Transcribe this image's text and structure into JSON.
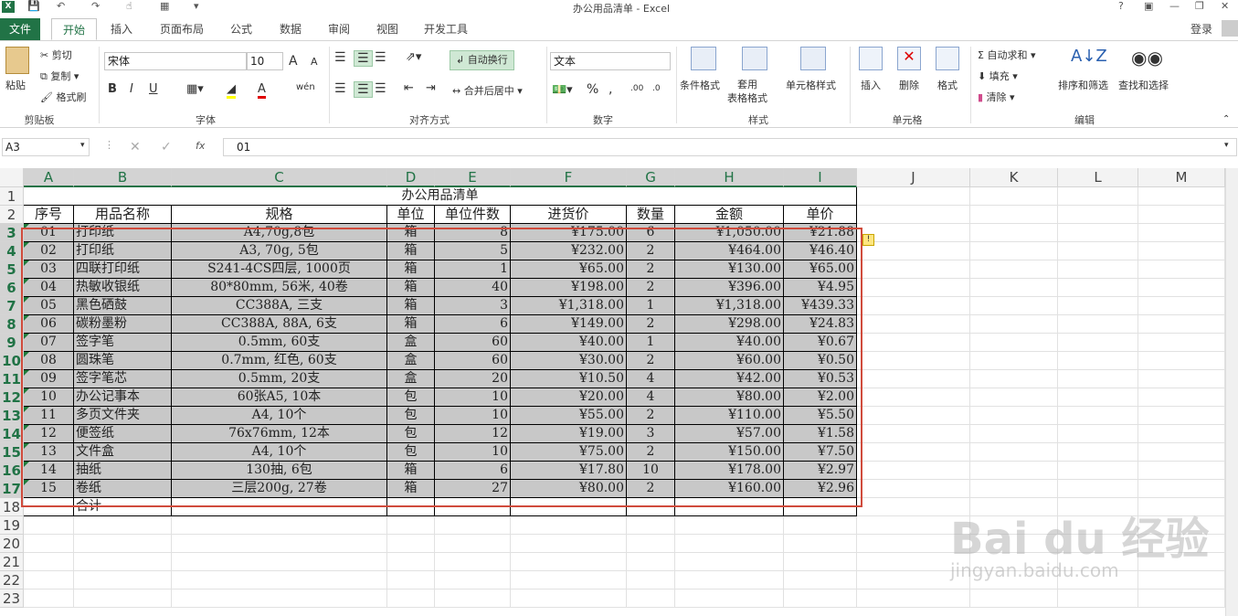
{
  "window": {
    "title": "办公用品清单 - Excel",
    "help": "?",
    "controls": [
      "▣",
      "—",
      "❐",
      "✕"
    ]
  },
  "tabs": [
    "文件",
    "开始",
    "插入",
    "页面布局",
    "公式",
    "数据",
    "审阅",
    "视图",
    "开发工具"
  ],
  "active_tab": "开始",
  "login": "登录",
  "ribbon": {
    "clipboard": {
      "paste": "粘贴",
      "cut": "剪切",
      "copy": "复制",
      "format_painter": "格式刷",
      "label": "剪贴板"
    },
    "font": {
      "name": "宋体",
      "size": "10",
      "bold": "B",
      "italic": "I",
      "underline": "U",
      "label": "字体"
    },
    "align": {
      "wrap": "自动换行",
      "merge": "合并后居中",
      "label": "对齐方式"
    },
    "number": {
      "format": "文本",
      "percent": "%",
      "comma": ",",
      "label": "数字"
    },
    "styles": {
      "cond": "条件格式",
      "table": "套用\n表格格式",
      "cell": "单元格样式",
      "label": "样式"
    },
    "cells": {
      "insert": "插入",
      "delete": "删除",
      "format": "格式",
      "label": "单元格"
    },
    "editing": {
      "autosum": "自动求和",
      "fill": "填充",
      "clear": "清除",
      "sort": "排序和筛选",
      "find": "查找和选择",
      "label": "编辑"
    },
    "font_grow": "A",
    "font_shrink": "A"
  },
  "formula_bar": {
    "name_box": "A3",
    "fx": "fx",
    "value": "01"
  },
  "columns": [
    "A",
    "B",
    "C",
    "D",
    "E",
    "F",
    "G",
    "H",
    "I",
    "J",
    "K",
    "L",
    "M"
  ],
  "rows": [
    "1",
    "2",
    "3",
    "4",
    "5",
    "6",
    "7",
    "8",
    "9",
    "10",
    "11",
    "12",
    "13",
    "14",
    "15",
    "16",
    "17",
    "18",
    "19",
    "20",
    "21",
    "22",
    "23"
  ],
  "sheet": {
    "title": "办公用品清单",
    "headers": [
      "序号",
      "用品名称",
      "规格",
      "单位",
      "单位件数",
      "进货价",
      "数量",
      "金额",
      "单价"
    ],
    "data": [
      [
        "01",
        "打印纸",
        "A4,70g,8包",
        "箱",
        "8",
        "¥175.00",
        "6",
        "¥1,050.00",
        "¥21.88"
      ],
      [
        "02",
        "打印纸",
        "A3, 70g, 5包",
        "箱",
        "5",
        "¥232.00",
        "2",
        "¥464.00",
        "¥46.40"
      ],
      [
        "03",
        "四联打印纸",
        "S241-4CS四层, 1000页",
        "箱",
        "1",
        "¥65.00",
        "2",
        "¥130.00",
        "¥65.00"
      ],
      [
        "04",
        "热敏收银纸",
        "80*80mm, 56米, 40卷",
        "箱",
        "40",
        "¥198.00",
        "2",
        "¥396.00",
        "¥4.95"
      ],
      [
        "05",
        "黑色硒鼓",
        "CC388A, 三支",
        "箱",
        "3",
        "¥1,318.00",
        "1",
        "¥1,318.00",
        "¥439.33"
      ],
      [
        "06",
        "碳粉墨粉",
        "CC388A, 88A, 6支",
        "箱",
        "6",
        "¥149.00",
        "2",
        "¥298.00",
        "¥24.83"
      ],
      [
        "07",
        "签字笔",
        "0.5mm, 60支",
        "盒",
        "60",
        "¥40.00",
        "1",
        "¥40.00",
        "¥0.67"
      ],
      [
        "08",
        "圆珠笔",
        "0.7mm, 红色, 60支",
        "盒",
        "60",
        "¥30.00",
        "2",
        "¥60.00",
        "¥0.50"
      ],
      [
        "09",
        "签字笔芯",
        "0.5mm, 20支",
        "盒",
        "20",
        "¥10.50",
        "4",
        "¥42.00",
        "¥0.53"
      ],
      [
        "10",
        "办公记事本",
        "60张A5, 10本",
        "包",
        "10",
        "¥20.00",
        "4",
        "¥80.00",
        "¥2.00"
      ],
      [
        "11",
        "多页文件夹",
        "A4, 10个",
        "包",
        "10",
        "¥55.00",
        "2",
        "¥110.00",
        "¥5.50"
      ],
      [
        "12",
        "便签纸",
        "76x76mm, 12本",
        "包",
        "12",
        "¥19.00",
        "3",
        "¥57.00",
        "¥1.58"
      ],
      [
        "13",
        "文件盒",
        "A4, 10个",
        "包",
        "10",
        "¥75.00",
        "2",
        "¥150.00",
        "¥7.50"
      ],
      [
        "14",
        "抽纸",
        "130抽, 6包",
        "箱",
        "6",
        "¥17.80",
        "10",
        "¥178.00",
        "¥2.97"
      ],
      [
        "15",
        "卷纸",
        "三层200g, 27卷",
        "箱",
        "27",
        "¥80.00",
        "2",
        "¥160.00",
        "¥2.96"
      ]
    ],
    "total_label": "合计",
    "total_value": "--"
  },
  "watermark": {
    "main": "Bai du 经验",
    "sub": "jingyan.baidu.com"
  }
}
